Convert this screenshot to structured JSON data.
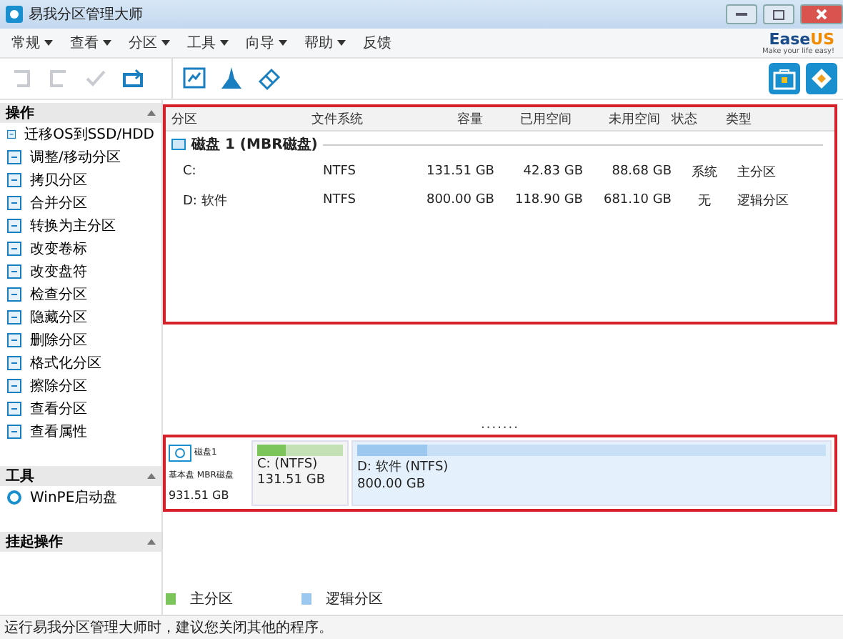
{
  "window": {
    "title": "易我分区管理大师"
  },
  "menu": [
    {
      "label": "常规",
      "has_dropdown": true
    },
    {
      "label": "查看",
      "has_dropdown": true
    },
    {
      "label": "分区",
      "has_dropdown": true
    },
    {
      "label": "工具",
      "has_dropdown": true
    },
    {
      "label": "向导",
      "has_dropdown": true
    },
    {
      "label": "帮助",
      "has_dropdown": true
    },
    {
      "label": "反馈",
      "has_dropdown": false
    }
  ],
  "logo": {
    "brand": "Ease",
    "accent": "US",
    "tagline": "Make your life easy!"
  },
  "toolbar": [
    {
      "kind": "undo",
      "disabled": true
    },
    {
      "kind": "redo",
      "disabled": true
    },
    {
      "kind": "apply",
      "disabled": true
    },
    {
      "kind": "refresh",
      "disabled": false
    },
    {
      "kind": "migrate",
      "disabled": false
    },
    {
      "kind": "cleanup",
      "disabled": false
    },
    {
      "kind": "wipe",
      "disabled": false
    }
  ],
  "toolbar_right": [
    {
      "kind": "toolkit"
    },
    {
      "kind": "diamond"
    }
  ],
  "sidebar": [
    {
      "title": "操作",
      "expanded": true,
      "items": [
        {
          "label": "迁移OS到SSD/HDD"
        },
        {
          "label": "调整/移动分区"
        },
        {
          "label": "拷贝分区"
        },
        {
          "label": "合并分区"
        },
        {
          "label": "转换为主分区"
        },
        {
          "label": "改变卷标"
        },
        {
          "label": "改变盘符"
        },
        {
          "label": "检查分区"
        },
        {
          "label": "隐藏分区"
        },
        {
          "label": "删除分区"
        },
        {
          "label": "格式化分区"
        },
        {
          "label": "擦除分区"
        },
        {
          "label": "查看分区"
        },
        {
          "label": "查看属性"
        }
      ]
    },
    {
      "title": "工具",
      "expanded": true,
      "items": [
        {
          "label": "WinPE启动盘"
        }
      ]
    },
    {
      "title": "挂起操作",
      "expanded": true
    }
  ],
  "table": {
    "columns": [
      "分区",
      "文件系统",
      "容量",
      "已用空间",
      "未用空间",
      "状态",
      "类型"
    ],
    "disk": "磁盘 1 (MBR磁盘)",
    "rows": [
      [
        "C:",
        "NTFS",
        "131.51 GB",
        "42.83 GB",
        "88.68 GB",
        "系统",
        "主分区"
      ],
      [
        "D: 软件",
        "NTFS",
        "800.00 GB",
        "118.90 GB",
        "681.10 GB",
        "无",
        "逻辑分区"
      ]
    ]
  },
  "splitter": "·······",
  "disk_map": {
    "name": "磁盘1",
    "type": "基本盘 MBR磁盘",
    "size": "931.51 GB",
    "partitions": [
      {
        "label": "C: (NTFS)",
        "size": "131.51 GB",
        "kind": "primary",
        "level": 0.33
      },
      {
        "label": "D: 软件 (NTFS)",
        "size": "800.00 GB",
        "kind": "logical",
        "level": 0.15
      }
    ]
  },
  "legend": [
    {
      "label": "主分区",
      "color": "#7cc55a"
    },
    {
      "label": "逻辑分区",
      "color": "#9cc8f0"
    }
  ],
  "status_bar": "运行易我分区管理大师时，建议您关闭其他的程序。"
}
